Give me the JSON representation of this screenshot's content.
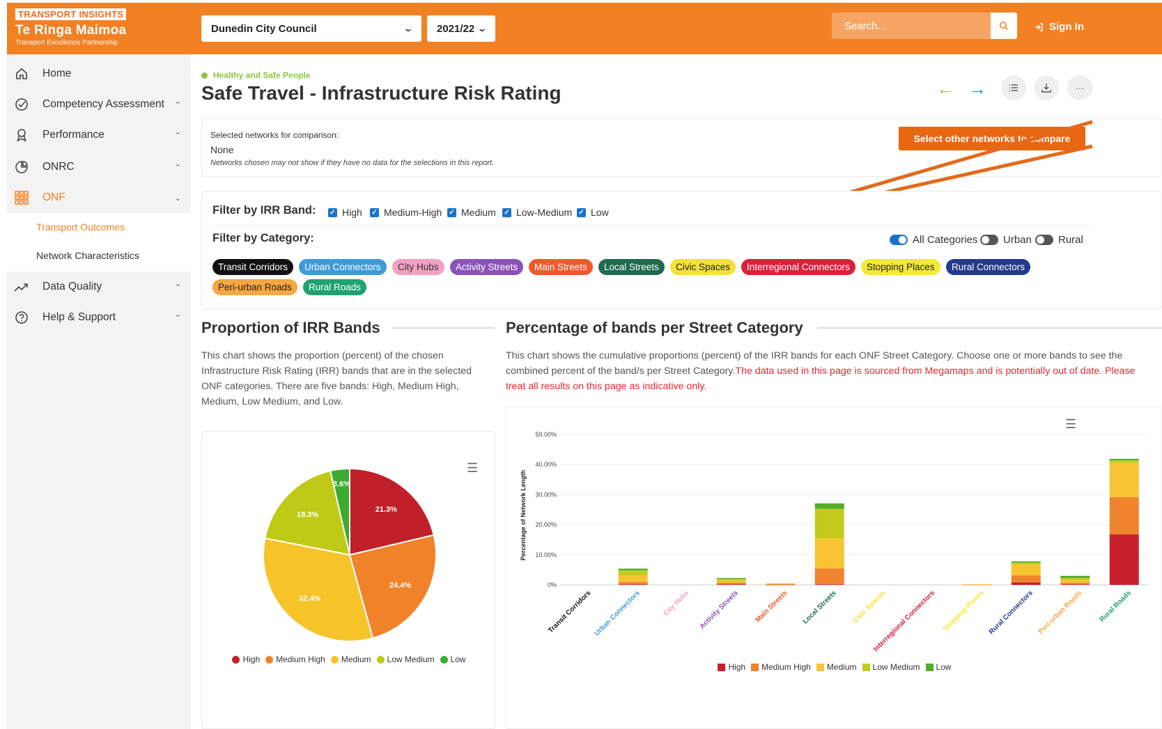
{
  "header": {
    "badge": "TRANSPORT INSIGHTS",
    "app_name": "Te Ringa Maimoa",
    "app_sub": "Transport Excellence Partnership",
    "council": "Dunedin City Council",
    "year": "2021/22",
    "search_placeholder": "Search...",
    "sign_in": "Sign In"
  },
  "sidebar": {
    "items": [
      {
        "label": "Home"
      },
      {
        "label": "Competency Assessment"
      },
      {
        "label": "Performance"
      },
      {
        "label": "ONRC"
      },
      {
        "label": "ONF"
      },
      {
        "label": "Data Quality"
      },
      {
        "label": "Help & Support"
      }
    ],
    "sub_items": [
      {
        "label": "Transport Outcomes"
      },
      {
        "label": "Network Characteristics"
      }
    ]
  },
  "page": {
    "breadcrumb": "Healthy and Safe People",
    "title": "Safe Travel - Infrastructure Risk Rating"
  },
  "compare": {
    "label": "Selected networks for comparison:",
    "value": "None",
    "note": "Networks chosen may not show if they have no data for the selections in this report.",
    "button": "Select other networks to compare"
  },
  "filters": {
    "irr_label": "Filter by IRR Band:",
    "irr_bands": [
      "High",
      "Medium-High",
      "Medium",
      "Low-Medium",
      "Low"
    ],
    "category_label": "Filter by Category:",
    "toggles": [
      {
        "label": "All Categories",
        "on": true
      },
      {
        "label": "Urban",
        "on": false
      },
      {
        "label": "Rural",
        "on": false
      }
    ],
    "chips": [
      {
        "label": "Transit Corridors",
        "color": "#111111"
      },
      {
        "label": "Urban Connectors",
        "color": "#3d9bd9"
      },
      {
        "label": "City Hubs",
        "color": "#f2a0c4"
      },
      {
        "label": "Activity Streets",
        "color": "#8a52b8"
      },
      {
        "label": "Main Streets",
        "color": "#ef5a2a"
      },
      {
        "label": "Local Streets",
        "color": "#1e6b4e"
      },
      {
        "label": "Civic Spaces",
        "color": "#f4e13a"
      },
      {
        "label": "Interregional Connectors",
        "color": "#d8213a"
      },
      {
        "label": "Stopping Places",
        "color": "#f4e83a"
      },
      {
        "label": "Rural Connectors",
        "color": "#233a8c"
      },
      {
        "label": "Peri-urban Roads",
        "color": "#f5a742"
      },
      {
        "label": "Rural Roads",
        "color": "#1fa26e"
      }
    ]
  },
  "pie_section": {
    "title": "Proportion of IRR Bands",
    "desc": "This chart shows the proportion (percent) of the chosen Infrastructure Risk Rating (IRR) bands that are in the selected ONF categories. There are five bands: High, Medium High, Medium, Low Medium, and Low."
  },
  "bar_section": {
    "title": "Percentage of bands per Street Category",
    "desc": "This chart shows the cumulative proportions (percent) of the IRR bands for each ONF Street Category. Choose one or more bands to see the combined percent of the band/s per Street Category.",
    "warning": "The data used in this page is sourced from Megamaps and is potentially out of date. Please treat all results on this page as indicative only."
  },
  "chart_data": [
    {
      "type": "pie",
      "series": [
        {
          "name": "High",
          "value": 21.3,
          "color": "#c0202a"
        },
        {
          "name": "Medium High",
          "value": 24.4,
          "color": "#f0822a"
        },
        {
          "name": "Medium",
          "value": 32.4,
          "color": "#f6c429"
        },
        {
          "name": "Low Medium",
          "value": 18.3,
          "color": "#bfca16"
        },
        {
          "name": "Low",
          "value": 3.6,
          "color": "#3cab2f"
        }
      ],
      "labels": [
        "21.3%",
        "24.4%",
        "32.4%",
        "18.3%",
        "3.6%"
      ]
    },
    {
      "type": "bar",
      "stacked": true,
      "ylabel": "Percentage of Network Length",
      "yticks": [
        "0%",
        "10.00%",
        "20.00%",
        "30.00%",
        "40.00%",
        "50.00%"
      ],
      "ylim": [
        0,
        50
      ],
      "categories": [
        "Transit Corridors",
        "Urban Connectors",
        "City Hubs",
        "Activity Streets",
        "Main Streets",
        "Local Streets",
        "Civic Spaces",
        "Interregional Connectors",
        "Stopping Places",
        "Rural Connectors",
        "Peri-urban Roads",
        "Rural Roads"
      ],
      "category_colors": [
        "#111111",
        "#3d9bd9",
        "#f2a0c4",
        "#8a52b8",
        "#ef5a2a",
        "#1e6b4e",
        "#f4e13a",
        "#d8213a",
        "#f4e83a",
        "#233a8c",
        "#f5a742",
        "#1fa26e"
      ],
      "series": [
        {
          "name": "High",
          "color": "#c9202e",
          "values": [
            0,
            0.2,
            0,
            0.2,
            0.1,
            0.2,
            0,
            0,
            0,
            0.8,
            0.2,
            16.8
          ]
        },
        {
          "name": "Medium High",
          "color": "#f0842e",
          "values": [
            0,
            0.8,
            0,
            0.5,
            0.1,
            5.3,
            0,
            0,
            0.1,
            2.4,
            0.5,
            12.4
          ]
        },
        {
          "name": "Medium",
          "color": "#f8c433",
          "values": [
            0,
            2.1,
            0,
            0.7,
            0.2,
            10.0,
            0,
            0,
            0.1,
            3.6,
            0.9,
            11.4
          ]
        },
        {
          "name": "Low Medium",
          "color": "#c3cc1e",
          "values": [
            0,
            1.7,
            0,
            0.6,
            0.1,
            9.8,
            0,
            0,
            0,
            0.6,
            0.7,
            0.8
          ]
        },
        {
          "name": "Low",
          "color": "#53ad2d",
          "values": [
            0,
            0.6,
            0,
            0.3,
            0,
            1.8,
            0,
            0,
            0,
            0.4,
            0.7,
            0.5
          ]
        }
      ],
      "legend": [
        "High",
        "Medium High",
        "Medium",
        "Low Medium",
        "Low"
      ]
    }
  ]
}
